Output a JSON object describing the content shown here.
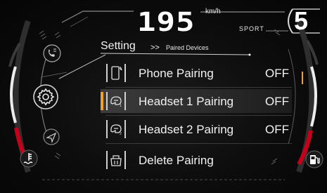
{
  "cluster": {
    "speed": "195",
    "speed_unit": "km/h",
    "drive_mode": "SPORT",
    "gear": "5"
  },
  "header": {
    "title": "Setting",
    "breadcrumb_separator": ">>",
    "breadcrumb": "Paired Devices"
  },
  "menu": {
    "items": [
      {
        "label": "Phone Pairing",
        "value": "OFF",
        "icon": "phone-icon",
        "selected": false
      },
      {
        "label": "Headset 1 Pairing",
        "value": "OFF",
        "icon": "headset-1-icon",
        "selected": true
      },
      {
        "label": "Headset 2 Pairing",
        "value": "OFF",
        "icon": "headset-2-icon",
        "selected": false
      },
      {
        "label": "Delete Pairing",
        "value": "",
        "icon": "delete-icon",
        "selected": false
      }
    ]
  },
  "side_icons": {
    "left": [
      "phone-call-icon",
      "gear-icon",
      "navigation-icon",
      "coolant-temp-icon"
    ],
    "right": [
      "fuel-icon"
    ]
  },
  "colors": {
    "accent": "#f0a030",
    "text": "#f2f2f2",
    "background": "#0b0b0b",
    "red_zone": "#c4001a"
  }
}
